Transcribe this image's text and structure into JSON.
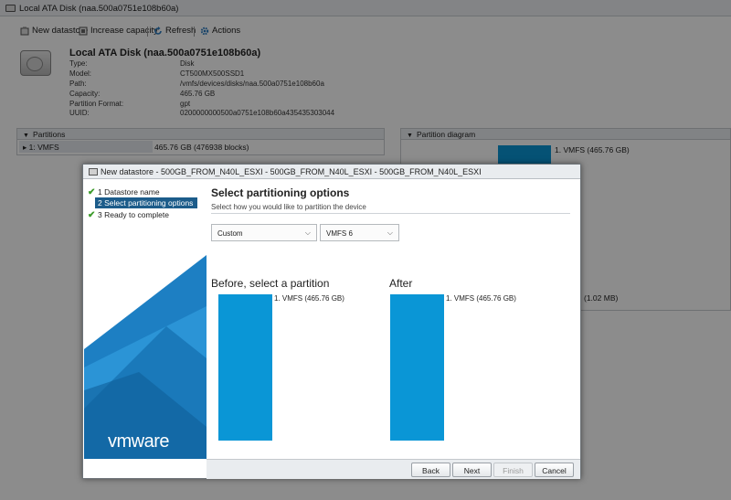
{
  "background": {
    "window_title": "Local ATA Disk (naa.500a0751e108b60a)",
    "toolbar": {
      "new_datastore": "New datastore",
      "increase_capacity": "Increase capacity",
      "refresh": "Refresh",
      "actions": "Actions"
    },
    "disk": {
      "title": "Local ATA Disk (naa.500a0751e108b60a)",
      "properties": [
        {
          "label": "Type:",
          "value": "Disk"
        },
        {
          "label": "Model:",
          "value": "CT500MX500SSD1"
        },
        {
          "label": "Path:",
          "value": "/vmfs/devices/disks/naa.500a0751e108b60a"
        },
        {
          "label": "Capacity:",
          "value": "465.76 GB"
        },
        {
          "label": "Partition Format:",
          "value": "gpt"
        },
        {
          "label": "UUID:",
          "value": "0200000000500a0751e108b60a435435303044"
        }
      ]
    },
    "partitions_panel": {
      "header": "Partitions",
      "row_name": "1: VMFS",
      "row_value": "465.76 GB (476938 blocks)"
    },
    "diagram_panel": {
      "header": "Partition diagram",
      "label1": "1. VMFS   (465.76 GB)",
      "label2": "(1.02 MB)"
    }
  },
  "dialog": {
    "title": "New datastore - 500GB_FROM_N40L_ESXI - 500GB_FROM_N40L_ESXI - 500GB_FROM_N40L_ESXI",
    "steps": [
      {
        "label": "1 Datastore name",
        "done": true
      },
      {
        "label": "2 Select partitioning options",
        "active": true
      },
      {
        "label": "3 Ready to complete",
        "done": true
      }
    ],
    "logo": "vmware",
    "heading": "Select partitioning options",
    "subheading": "Select how you would like to partition the device",
    "partition_select": "Custom",
    "fs_select": "VMFS 6",
    "before_title": "Before, select a partition",
    "after_title": "After",
    "before_label": "1. VMFS   (465.76 GB)",
    "after_label": "1. VMFS   (465.76 GB)",
    "buttons": {
      "back": "Back",
      "next": "Next",
      "finish": "Finish",
      "cancel": "Cancel"
    },
    "colors": {
      "accent": "#0a96d6",
      "active_step": "#1c5c8a",
      "sidebar_blue": "#1d7fc3"
    }
  }
}
